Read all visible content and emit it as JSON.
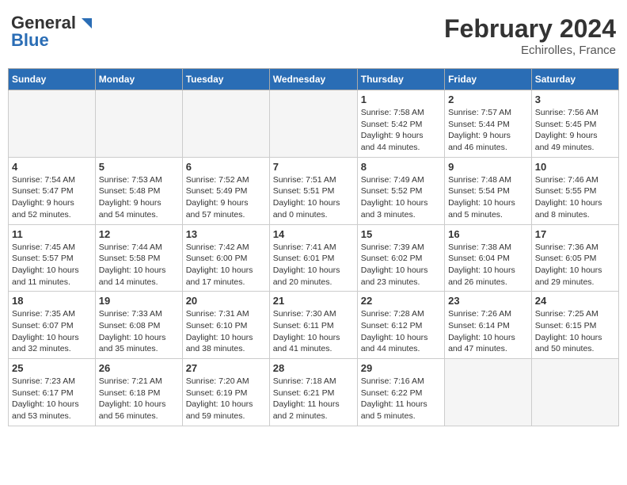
{
  "header": {
    "logo_general": "General",
    "logo_blue": "Blue",
    "title": "February 2024",
    "subtitle": "Echirolles, France"
  },
  "days_of_week": [
    "Sunday",
    "Monday",
    "Tuesday",
    "Wednesday",
    "Thursday",
    "Friday",
    "Saturday"
  ],
  "weeks": [
    [
      {
        "day": "",
        "info": ""
      },
      {
        "day": "",
        "info": ""
      },
      {
        "day": "",
        "info": ""
      },
      {
        "day": "",
        "info": ""
      },
      {
        "day": "1",
        "info": "Sunrise: 7:58 AM\nSunset: 5:42 PM\nDaylight: 9 hours\nand 44 minutes."
      },
      {
        "day": "2",
        "info": "Sunrise: 7:57 AM\nSunset: 5:44 PM\nDaylight: 9 hours\nand 46 minutes."
      },
      {
        "day": "3",
        "info": "Sunrise: 7:56 AM\nSunset: 5:45 PM\nDaylight: 9 hours\nand 49 minutes."
      }
    ],
    [
      {
        "day": "4",
        "info": "Sunrise: 7:54 AM\nSunset: 5:47 PM\nDaylight: 9 hours\nand 52 minutes."
      },
      {
        "day": "5",
        "info": "Sunrise: 7:53 AM\nSunset: 5:48 PM\nDaylight: 9 hours\nand 54 minutes."
      },
      {
        "day": "6",
        "info": "Sunrise: 7:52 AM\nSunset: 5:49 PM\nDaylight: 9 hours\nand 57 minutes."
      },
      {
        "day": "7",
        "info": "Sunrise: 7:51 AM\nSunset: 5:51 PM\nDaylight: 10 hours\nand 0 minutes."
      },
      {
        "day": "8",
        "info": "Sunrise: 7:49 AM\nSunset: 5:52 PM\nDaylight: 10 hours\nand 3 minutes."
      },
      {
        "day": "9",
        "info": "Sunrise: 7:48 AM\nSunset: 5:54 PM\nDaylight: 10 hours\nand 5 minutes."
      },
      {
        "day": "10",
        "info": "Sunrise: 7:46 AM\nSunset: 5:55 PM\nDaylight: 10 hours\nand 8 minutes."
      }
    ],
    [
      {
        "day": "11",
        "info": "Sunrise: 7:45 AM\nSunset: 5:57 PM\nDaylight: 10 hours\nand 11 minutes."
      },
      {
        "day": "12",
        "info": "Sunrise: 7:44 AM\nSunset: 5:58 PM\nDaylight: 10 hours\nand 14 minutes."
      },
      {
        "day": "13",
        "info": "Sunrise: 7:42 AM\nSunset: 6:00 PM\nDaylight: 10 hours\nand 17 minutes."
      },
      {
        "day": "14",
        "info": "Sunrise: 7:41 AM\nSunset: 6:01 PM\nDaylight: 10 hours\nand 20 minutes."
      },
      {
        "day": "15",
        "info": "Sunrise: 7:39 AM\nSunset: 6:02 PM\nDaylight: 10 hours\nand 23 minutes."
      },
      {
        "day": "16",
        "info": "Sunrise: 7:38 AM\nSunset: 6:04 PM\nDaylight: 10 hours\nand 26 minutes."
      },
      {
        "day": "17",
        "info": "Sunrise: 7:36 AM\nSunset: 6:05 PM\nDaylight: 10 hours\nand 29 minutes."
      }
    ],
    [
      {
        "day": "18",
        "info": "Sunrise: 7:35 AM\nSunset: 6:07 PM\nDaylight: 10 hours\nand 32 minutes."
      },
      {
        "day": "19",
        "info": "Sunrise: 7:33 AM\nSunset: 6:08 PM\nDaylight: 10 hours\nand 35 minutes."
      },
      {
        "day": "20",
        "info": "Sunrise: 7:31 AM\nSunset: 6:10 PM\nDaylight: 10 hours\nand 38 minutes."
      },
      {
        "day": "21",
        "info": "Sunrise: 7:30 AM\nSunset: 6:11 PM\nDaylight: 10 hours\nand 41 minutes."
      },
      {
        "day": "22",
        "info": "Sunrise: 7:28 AM\nSunset: 6:12 PM\nDaylight: 10 hours\nand 44 minutes."
      },
      {
        "day": "23",
        "info": "Sunrise: 7:26 AM\nSunset: 6:14 PM\nDaylight: 10 hours\nand 47 minutes."
      },
      {
        "day": "24",
        "info": "Sunrise: 7:25 AM\nSunset: 6:15 PM\nDaylight: 10 hours\nand 50 minutes."
      }
    ],
    [
      {
        "day": "25",
        "info": "Sunrise: 7:23 AM\nSunset: 6:17 PM\nDaylight: 10 hours\nand 53 minutes."
      },
      {
        "day": "26",
        "info": "Sunrise: 7:21 AM\nSunset: 6:18 PM\nDaylight: 10 hours\nand 56 minutes."
      },
      {
        "day": "27",
        "info": "Sunrise: 7:20 AM\nSunset: 6:19 PM\nDaylight: 10 hours\nand 59 minutes."
      },
      {
        "day": "28",
        "info": "Sunrise: 7:18 AM\nSunset: 6:21 PM\nDaylight: 11 hours\nand 2 minutes."
      },
      {
        "day": "29",
        "info": "Sunrise: 7:16 AM\nSunset: 6:22 PM\nDaylight: 11 hours\nand 5 minutes."
      },
      {
        "day": "",
        "info": ""
      },
      {
        "day": "",
        "info": ""
      }
    ]
  ]
}
